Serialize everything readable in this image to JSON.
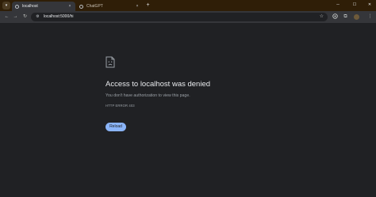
{
  "tabs": [
    {
      "title": "localhost",
      "active": true,
      "close": "×"
    },
    {
      "title": "ChatGPT",
      "active": false,
      "close": "×"
    }
  ],
  "tabstrip": {
    "menu_glyph": "▾",
    "new_tab_glyph": "+"
  },
  "window_controls": {
    "minimize": "─",
    "maximize": "☐",
    "close": "✕"
  },
  "toolbar": {
    "back_glyph": "←",
    "forward_glyph": "→",
    "reload_glyph": "↻",
    "site_info_glyph": "⚙",
    "url": "localhost:5000/hi",
    "bookmark_glyph": "☆",
    "extensions_glyph": "⧉",
    "menu_glyph": "⋮"
  },
  "error_page": {
    "title": "Access to localhost was denied",
    "description": "You don't have authorization to view this page.",
    "code": "HTTP ERROR 403",
    "reload_label": "Reload"
  },
  "colors": {
    "tabstrip": "#2f1e07",
    "toolbar": "#35363a",
    "page_background": "#202124",
    "reload_button": "#8ab4f8"
  }
}
